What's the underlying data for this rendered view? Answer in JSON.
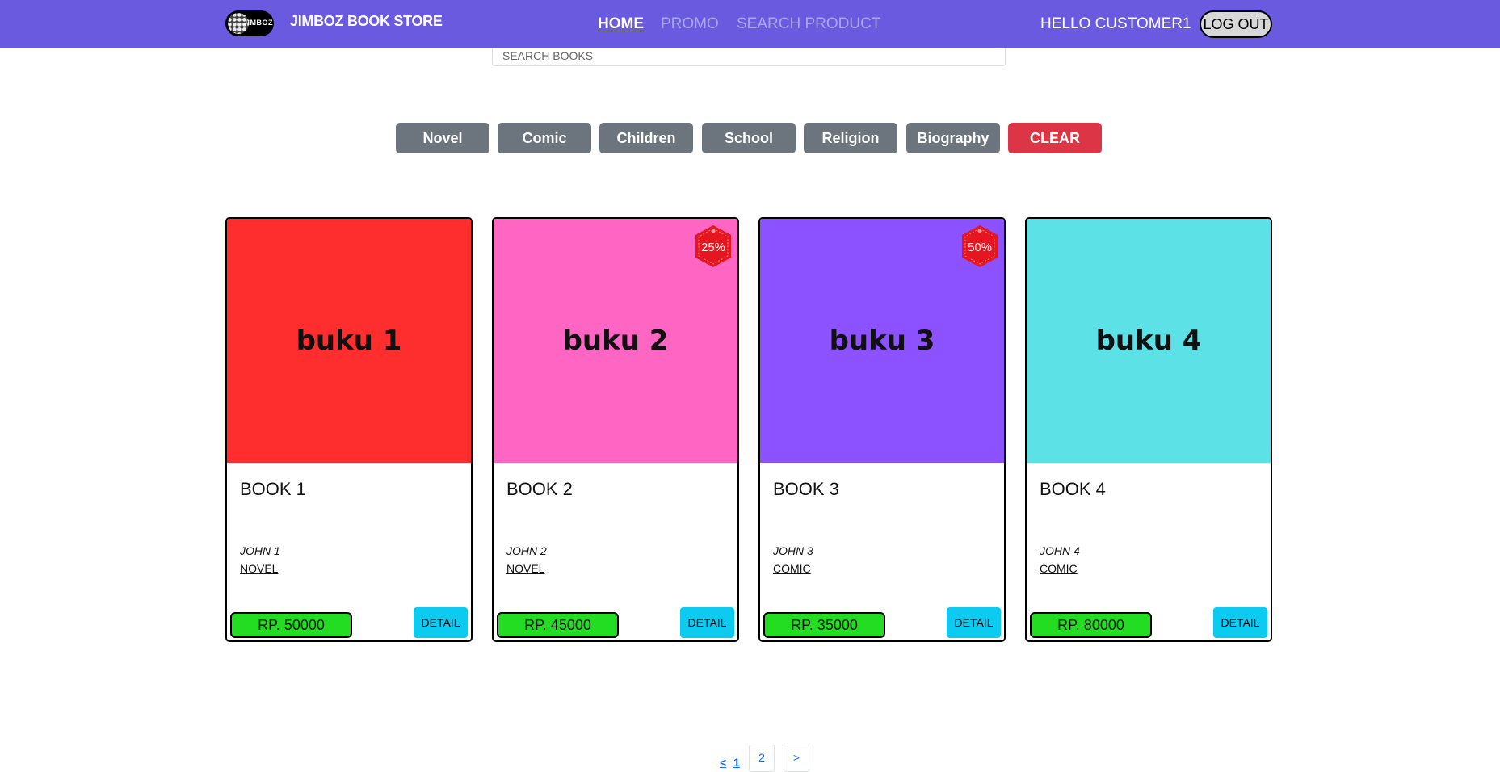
{
  "navbar": {
    "logo_text": "JIMBOZ",
    "brand": "JIMBOZ BOOK STORE",
    "links": [
      "HOME",
      "PROMO",
      "SEARCH PRODUCT"
    ],
    "greeting": "HELLO CUSTOMER1",
    "logout_label": "LOG OUT"
  },
  "search": {
    "placeholder": "SEARCH BOOKS"
  },
  "filters": [
    "Novel",
    "Comic",
    "Children",
    "School",
    "Religion",
    "Biography"
  ],
  "clear_label": "CLEAR",
  "books": [
    {
      "cover_text": "buku 1",
      "cover_color": "#ff2e2e",
      "discount": "",
      "title": "BOOK 1",
      "author": "JOHN 1",
      "category": "NOVEL",
      "price": "RP. 50000",
      "detail_label": "DETAIL"
    },
    {
      "cover_text": "buku 2",
      "cover_color": "#ff66c4",
      "discount": "25%",
      "title": "BOOK 2",
      "author": "JOHN 2",
      "category": "NOVEL",
      "price": "RP. 45000",
      "detail_label": "DETAIL"
    },
    {
      "cover_text": "buku 3",
      "cover_color": "#8c52ff",
      "discount": "50%",
      "title": "BOOK 3",
      "author": "JOHN 3",
      "category": "COMIC",
      "price": "RP. 35000",
      "detail_label": "DETAIL"
    },
    {
      "cover_text": "buku 4",
      "cover_color": "#5ce1e6",
      "discount": "",
      "title": "BOOK 4",
      "author": "JOHN 4",
      "category": "COMIC",
      "price": "RP. 80000",
      "detail_label": "DETAIL"
    }
  ],
  "pagination": {
    "prev": "<",
    "page1": "1",
    "page2": "2",
    "next": ">"
  },
  "colors": {
    "navbar": "#6a5ae0",
    "filter_button": "#6c757d",
    "clear_button": "#dc3545",
    "price_badge": "#22dd22",
    "detail_button": "#0dcaf0",
    "discount_badge": "#e5161f"
  }
}
